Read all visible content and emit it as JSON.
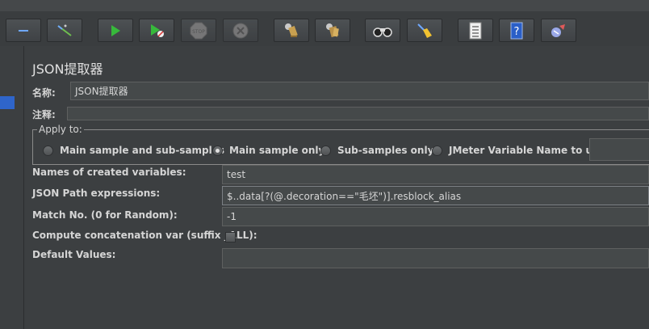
{
  "toolbar": {
    "buttons": [
      {
        "id": "collapse",
        "icon": "minus-icon"
      },
      {
        "id": "toggle",
        "icon": "wand-icon"
      },
      {
        "id": "start",
        "icon": "play-icon"
      },
      {
        "id": "start-no-pause",
        "icon": "play-no-timer-icon"
      },
      {
        "id": "stop",
        "icon": "stop-icon",
        "label": "STOP"
      },
      {
        "id": "shutdown",
        "icon": "shutdown-icon"
      },
      {
        "id": "clear",
        "icon": "broom-gear-icon"
      },
      {
        "id": "clear-all",
        "icon": "broom-gear-all-icon"
      },
      {
        "id": "search",
        "icon": "binoculars-icon"
      },
      {
        "id": "reset-search",
        "icon": "broom-icon"
      },
      {
        "id": "function-helper",
        "icon": "list-icon"
      },
      {
        "id": "help",
        "icon": "help-book-icon",
        "label": "?"
      },
      {
        "id": "remote",
        "icon": "remote-icon"
      }
    ]
  },
  "panel": {
    "title": "JSON提取器",
    "name_label": "名称:",
    "name_value": "JSON提取器",
    "comment_label": "注释:",
    "comment_value": ""
  },
  "apply_to": {
    "title": "Apply to:",
    "options": [
      {
        "label": "Main sample and sub-samples",
        "selected": false
      },
      {
        "label": "Main sample only",
        "selected": true
      },
      {
        "label": "Sub-samples only",
        "selected": false
      },
      {
        "label": "JMeter Variable Name to use",
        "selected": false
      }
    ],
    "variable_value": ""
  },
  "properties": {
    "names_label": "Names of created variables:",
    "names_value": "test",
    "paths_label": "JSON Path expressions:",
    "paths_value": "$..data[?(@.decoration==\"毛坯\")].resblock_alias",
    "match_label": "Match No. (0 for Random):",
    "match_value": "-1",
    "concat_label": "Compute concatenation var (suffix _ALL):",
    "concat_checked": false,
    "default_label": "Default Values:",
    "default_value": ""
  }
}
